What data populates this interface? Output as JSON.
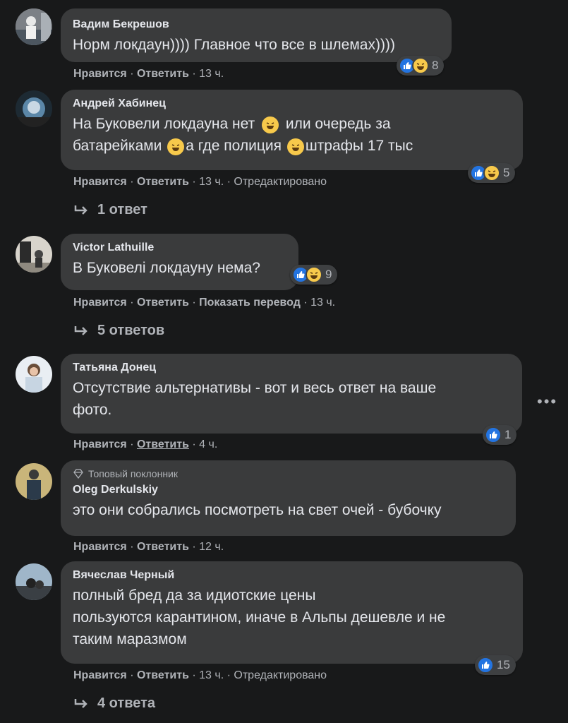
{
  "comments": [
    {
      "author": "Вадим Бекрешов",
      "lines": [
        "Норм локдаун)))) Главное что все в шлемах))))"
      ],
      "reactions": "8",
      "actions": {
        "like": "Нравится",
        "reply": "Ответить",
        "time": "13 ч."
      }
    },
    {
      "author": "Андрей Хабинец",
      "lines": [
        "На Буковели локдауна нет",
        "или очередь за",
        "батарейками",
        "а где полиция",
        "штрафы 17 тыс"
      ],
      "reactions": "5",
      "actions": {
        "like": "Нравится",
        "reply": "Ответить",
        "time": "13 ч.",
        "edited": "Отредактировано"
      },
      "replies": "1 ответ"
    },
    {
      "author": "Victor Lathuille",
      "lines": [
        "В Буковелі локдауну нема?"
      ],
      "reactions": "9",
      "actions": {
        "like": "Нравится",
        "reply": "Ответить",
        "translate": "Показать перевод",
        "time": "13 ч."
      },
      "replies": "5 ответов"
    },
    {
      "author": "Татьяна Донец",
      "lines": [
        "Отсутствие альтернативы - вот и весь ответ на ваше",
        "фото."
      ],
      "reactions": "1",
      "actions": {
        "like": "Нравится",
        "reply": "Ответить",
        "time": "4 ч."
      }
    },
    {
      "badge": "Топовый поклонник",
      "author": "Oleg Derkulskiy",
      "lines": [
        "это они собрались посмотреть на свет очей - бубочку"
      ],
      "actions": {
        "like": "Нравится",
        "reply": "Ответить",
        "time": "12 ч."
      }
    },
    {
      "author": "Вячеслав Черный",
      "lines": [
        "полный бред да за идиотские цены",
        "пользуются карантином, иначе в Альпы дешевле и не",
        "таким маразмом"
      ],
      "reactions": "15",
      "actions": {
        "like": "Нравится",
        "reply": "Ответить",
        "time": "13 ч.",
        "edited": "Отредактировано"
      },
      "replies": "4 ответа"
    }
  ],
  "separator": " · ",
  "icons": {
    "like": "like-icon",
    "haha": "haha-icon",
    "reply_arrow": "reply-arrow-icon",
    "more": "more-options-icon",
    "badge": "diamond-icon"
  },
  "colors": {
    "background": "#18191a",
    "bubble": "#3a3b3c",
    "like": "#2374e1",
    "haha": "#f7c94b"
  }
}
